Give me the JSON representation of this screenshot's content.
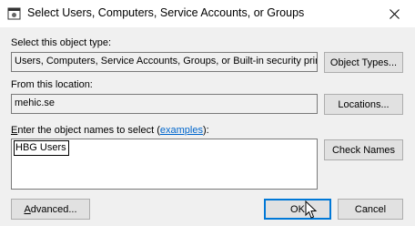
{
  "window": {
    "title": "Select Users, Computers, Service Accounts, or Groups"
  },
  "object_type": {
    "label_prefix": "",
    "label": "Select this object type:",
    "value": "Users, Computers, Service Accounts, Groups, or Built-in security princip",
    "button": "Object Types..."
  },
  "location": {
    "label": "From this location:",
    "value": "mehic.se",
    "button": "Locations..."
  },
  "names": {
    "label_accel": "E",
    "label_before_link": "nter the object names to select (",
    "link": "examples",
    "label_after_link": "):",
    "value": "HBG Users",
    "check_button": "Check Names"
  },
  "footer": {
    "advanced_accel": "A",
    "advanced_rest": "dvanced...",
    "ok": "OK",
    "cancel": "Cancel"
  },
  "icons": [
    "window-icon",
    "close-icon",
    "mouse-cursor-icon"
  ]
}
